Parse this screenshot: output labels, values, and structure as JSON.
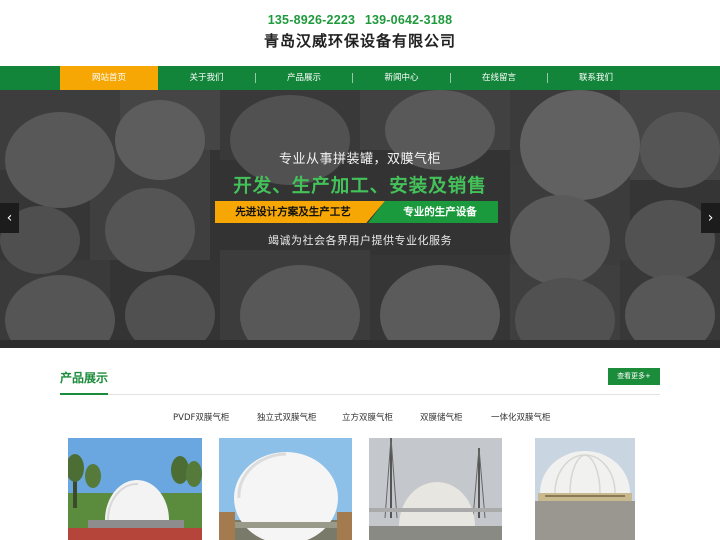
{
  "header": {
    "phone1": "135-8926-2223",
    "phone2": "139-0642-3188",
    "company": "青岛汉威环保设备有限公司"
  },
  "nav": {
    "items": [
      "网站首页",
      "关于我们",
      "产品展示",
      "新闻中心",
      "在线留言",
      "联系我们"
    ],
    "active_index": 0
  },
  "banner": {
    "line1": "专业从事拼装罐，双膜气柜",
    "line2": "开发、生产加工、安装及销售",
    "tag_left": "先进设计方案及生产工艺",
    "tag_right": "专业的生产设备",
    "line4": "竭诚为社会各界用户提供专业化服务",
    "arrow_left": "‹",
    "arrow_right": "›"
  },
  "products": {
    "title": "产品展示",
    "more": "查看更多+",
    "categories": [
      "PVDF双膜气柜",
      "独立式双膜气柜",
      "立方双膜气柜",
      "双膜储气柜",
      "一体化双膜气柜"
    ]
  },
  "colors": {
    "brand_green": "#13853a",
    "accent_orange": "#f6a704",
    "banner_green_text": "#44c25a"
  },
  "icons": {
    "arrow_left": "chevron-left-icon",
    "arrow_right": "chevron-right-icon"
  }
}
